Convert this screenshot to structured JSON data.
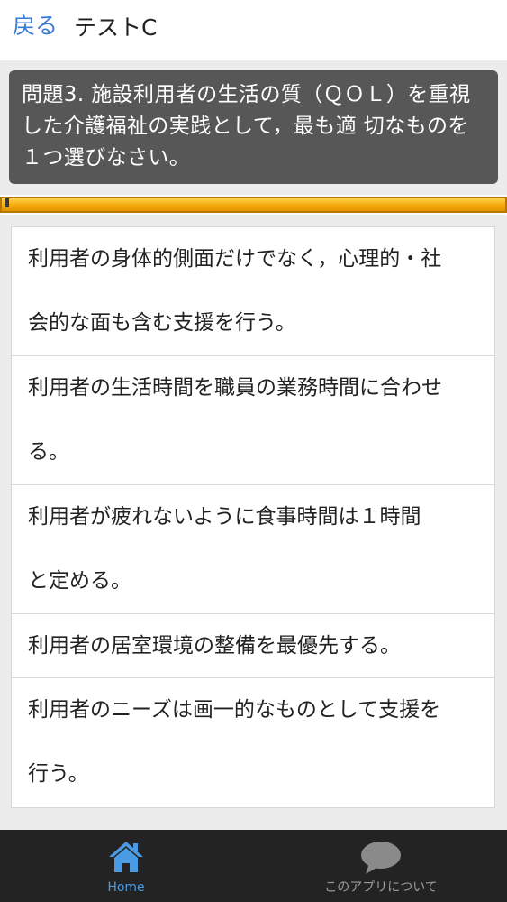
{
  "header": {
    "back_label": "戻る",
    "title": "テストC"
  },
  "question": {
    "text": "問題3. 施設利用者の生活の質（ＱＯＬ）を重視した介護福祉の実践として，最も適 切なものを１つ選びなさい。"
  },
  "progress": {
    "fraction": 1.0,
    "color": "#f4a90c"
  },
  "answers": [
    {
      "line1": "利用者の身体的側面だけでなく，心理的・社",
      "line2": "会的な面も含む支援を行う。"
    },
    {
      "line1": "利用者の生活時間を職員の業務時間に合わせ",
      "line2": "る。"
    },
    {
      "line1": "利用者が疲れないように食事時間は１時間",
      "line2": "と定める。"
    },
    {
      "line1": "利用者の居室環境の整備を最優先する。"
    },
    {
      "line1": "利用者のニーズは画一的なものとして支援を",
      "line2": "行う。"
    }
  ],
  "bottom_nav": {
    "items": [
      {
        "label": "Home",
        "icon": "home-icon",
        "active": true,
        "color": "#4a9be4"
      },
      {
        "label": "このアプリについて",
        "icon": "speech-bubble-icon",
        "active": false,
        "color": "#9a9a9a"
      }
    ]
  }
}
